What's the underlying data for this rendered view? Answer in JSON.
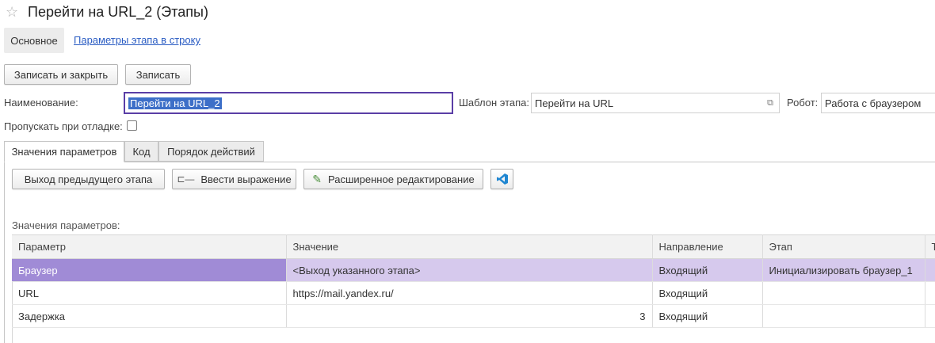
{
  "window": {
    "title": "Перейти на URL_2 (Этапы)"
  },
  "top_tabs": {
    "main": "Основное",
    "link": "Параметры этапа в строку"
  },
  "toolbar": {
    "save_close": "Записать и закрыть",
    "save": "Записать"
  },
  "form": {
    "name_label": "Наименование:",
    "name_value": "Перейти на URL_2",
    "template_label": "Шаблон этапа:",
    "template_value": "Перейти на URL",
    "robot_label": "Робот:",
    "robot_value": "Работа с браузером",
    "skip_label": "Пропускать при отладке:"
  },
  "inner_tabs": [
    "Значения параметров",
    "Код",
    "Порядок действий"
  ],
  "actions": {
    "prev_output": "Выход предыдущего этапа",
    "enter_expr": "Ввести выражение",
    "advanced_edit": "Расширенное редактирование"
  },
  "params_label": "Значения параметров:",
  "table": {
    "columns": [
      "Параметр",
      "Значение",
      "Направление",
      "Этап",
      "Т"
    ],
    "rows": [
      {
        "param": "Браузер",
        "value": "<Выход указанного этапа>",
        "direction": "Входящий",
        "stage": "Инициализировать браузер_1"
      },
      {
        "param": "URL",
        "value": "https://mail.yandex.ru/",
        "direction": "Входящий",
        "stage": ""
      },
      {
        "param": "Задержка",
        "value": "3",
        "direction": "Входящий",
        "stage": ""
      }
    ]
  },
  "icons": {
    "star": "star-icon",
    "open": "open-icon",
    "expression": "expression-icon",
    "pencil": "pencil-icon",
    "vscode": "vscode-icon"
  },
  "colors": {
    "selection_row": "#d6c9ed",
    "selection_cell": "#a08bd6",
    "link": "#2a5cc3",
    "active_field_border": "#5a3ea6"
  }
}
